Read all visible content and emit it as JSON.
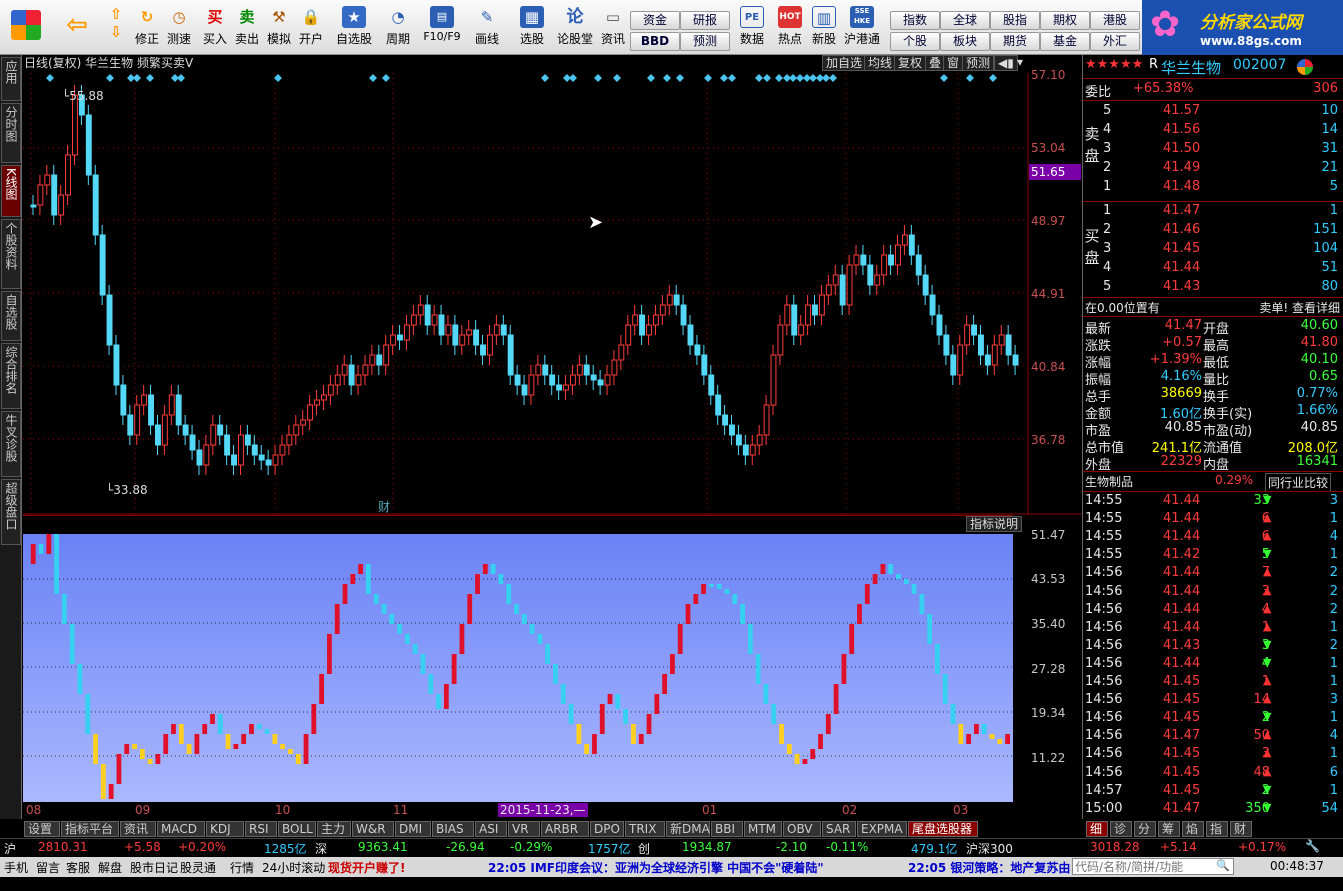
{
  "toolbar": {
    "buttons": [
      "修正",
      "测速",
      "买入",
      "卖出",
      "模拟",
      "开户",
      "自选股",
      "周期",
      "F10/F9",
      "画线",
      "选股",
      "论股堂",
      "资讯",
      "数据",
      "热点",
      "新股",
      "沪港通"
    ],
    "small_buttons": [
      "资金",
      "研报",
      "BBD",
      "预测",
      "指数",
      "全球",
      "股指",
      "期权",
      "港股",
      "个股",
      "板块",
      "期货",
      "基金",
      "外汇"
    ],
    "buy_icon": "买",
    "sell_icon": "卖",
    "lun_icon": "论",
    "pe_icon": "PE",
    "hot_icon": "HOT",
    "sse_icon": "SSE HKE"
  },
  "logo": {
    "title": "分析家公式网",
    "url": "www.88gs.com"
  },
  "left_tabs": [
    "应用",
    "分时图",
    "K线图",
    "个股资料",
    "自选股",
    "综合排名",
    "牛叉诊股",
    "超级盘口"
  ],
  "chart": {
    "header": "日线(复权)  华兰生物  频繁买卖V",
    "header_buttons": [
      "加自选",
      "均线",
      "复权",
      "叠",
      "窗",
      "预测"
    ],
    "high_label": "55.88",
    "low_label": "33.88",
    "cai_marker": "财",
    "price_axis": [
      "57.10",
      "53.04",
      "48.97",
      "44.91",
      "40.84",
      "36.78"
    ],
    "current_price_tag": "51.65",
    "indicator_btn": "指标说明",
    "ind_axis": [
      "51.47",
      "43.53",
      "35.40",
      "27.28",
      "19.34",
      "11.22"
    ],
    "x_labels": [
      "08",
      "09",
      "10",
      "11",
      "01",
      "02",
      "03"
    ],
    "date_cursor": "2015-11-23,—"
  },
  "bottom_tabs": [
    "设置",
    "指标平台",
    "资讯",
    "MACD",
    "KDJ",
    "RSI",
    "BOLL",
    "主力",
    "W&R",
    "DMI",
    "BIAS",
    "ASI",
    "VR",
    "ARBR",
    "DPO",
    "TRIX",
    "新DMA",
    "BBI",
    "MTM",
    "OBV",
    "SAR",
    "EXPMA",
    "尾盘选股器"
  ],
  "right_bottom_tabs": [
    "细",
    "诊",
    "分",
    "筹",
    "焰",
    "指",
    "财"
  ],
  "stock": {
    "name": "华兰生物",
    "code": "002007",
    "mark": "R",
    "weibi_label": "委比",
    "weibi": "+65.38%",
    "weibi_num": "306",
    "sell_label": "卖盘",
    "buy_label": "买盘",
    "asks": [
      {
        "lvl": "5",
        "price": "41.57",
        "vol": "10"
      },
      {
        "lvl": "4",
        "price": "41.56",
        "vol": "14"
      },
      {
        "lvl": "3",
        "price": "41.50",
        "vol": "31"
      },
      {
        "lvl": "2",
        "price": "41.49",
        "vol": "21"
      },
      {
        "lvl": "1",
        "price": "41.48",
        "vol": "5"
      }
    ],
    "bids": [
      {
        "lvl": "1",
        "price": "41.47",
        "vol": "1"
      },
      {
        "lvl": "2",
        "price": "41.46",
        "vol": "151"
      },
      {
        "lvl": "3",
        "price": "41.45",
        "vol": "104"
      },
      {
        "lvl": "4",
        "price": "41.44",
        "vol": "51"
      },
      {
        "lvl": "5",
        "price": "41.43",
        "vol": "80"
      }
    ],
    "pos_label": "在0.00位置有",
    "pos_right": "卖单! 查看详细",
    "stats": [
      {
        "k1": "最新",
        "v1": "41.47",
        "c1": "red",
        "k2": "开盘",
        "v2": "40.60",
        "c2": "grn"
      },
      {
        "k1": "涨跌",
        "v1": "+0.57",
        "c1": "red",
        "k2": "最高",
        "v2": "41.80",
        "c2": "red"
      },
      {
        "k1": "涨幅",
        "v1": "+1.39%",
        "c1": "red",
        "k2": "最低",
        "v2": "40.10",
        "c2": "grn"
      },
      {
        "k1": "振幅",
        "v1": "4.16%",
        "c1": "cyan",
        "k2": "量比",
        "v2": "0.65",
        "c2": "grn"
      },
      {
        "k1": "总手",
        "v1": "38669",
        "c1": "yel",
        "k2": "换手",
        "v2": "0.77%",
        "c2": "cyan"
      },
      {
        "k1": "金额",
        "v1": "1.60亿",
        "c1": "cyan",
        "k2": "换手(实)",
        "v2": "1.66%",
        "c2": "cyan"
      },
      {
        "k1": "市盈",
        "v1": "40.85",
        "c1": "wht",
        "k2": "市盈(动)",
        "v2": "40.85",
        "c2": "wht"
      },
      {
        "k1": "总市值",
        "v1": "241.1亿",
        "c1": "yel",
        "k2": "流通值",
        "v2": "208.0亿",
        "c2": "yel"
      },
      {
        "k1": "外盘",
        "v1": "22329",
        "c1": "red",
        "k2": "内盘",
        "v2": "16341",
        "c2": "grn"
      }
    ],
    "industry": "生物制品",
    "industry_pct": "0.29%",
    "industry_btn": "同行业比较",
    "ticks": [
      {
        "t": "14:55",
        "p": "41.44",
        "v": "33",
        "d": "down",
        "n": "3"
      },
      {
        "t": "14:55",
        "p": "41.44",
        "v": "6",
        "d": "up",
        "n": "1"
      },
      {
        "t": "14:55",
        "p": "41.44",
        "v": "6",
        "d": "up",
        "n": "4"
      },
      {
        "t": "14:55",
        "p": "41.42",
        "v": "5",
        "d": "down",
        "n": "1"
      },
      {
        "t": "14:56",
        "p": "41.44",
        "v": "7",
        "d": "up",
        "n": "2"
      },
      {
        "t": "14:56",
        "p": "41.44",
        "v": "3",
        "d": "up",
        "n": "2"
      },
      {
        "t": "14:56",
        "p": "41.44",
        "v": "4",
        "d": "up",
        "n": "2"
      },
      {
        "t": "14:56",
        "p": "41.44",
        "v": "1",
        "d": "up",
        "n": "1"
      },
      {
        "t": "14:56",
        "p": "41.43",
        "v": "3",
        "d": "down",
        "n": "2"
      },
      {
        "t": "14:56",
        "p": "41.44",
        "v": "4",
        "d": "down",
        "n": "1"
      },
      {
        "t": "14:56",
        "p": "41.45",
        "v": "1",
        "d": "up",
        "n": "1"
      },
      {
        "t": "14:56",
        "p": "41.45",
        "v": "14",
        "d": "up",
        "n": "3"
      },
      {
        "t": "14:56",
        "p": "41.45",
        "v": "2",
        "d": "down",
        "n": "1"
      },
      {
        "t": "14:56",
        "p": "41.47",
        "v": "50",
        "d": "up",
        "n": "4"
      },
      {
        "t": "14:56",
        "p": "41.45",
        "v": "3",
        "d": "up",
        "n": "1"
      },
      {
        "t": "14:56",
        "p": "41.45",
        "v": "48",
        "d": "up",
        "n": "6"
      },
      {
        "t": "14:57",
        "p": "41.45",
        "v": "2",
        "d": "down",
        "n": "1"
      },
      {
        "t": "15:00",
        "p": "41.47",
        "v": "350",
        "d": "down",
        "n": "54"
      }
    ]
  },
  "status": {
    "sh_label": "沪",
    "sh_val": "2810.31",
    "sh_chg": "+5.58",
    "sh_pct": "+0.20%",
    "sh_amt": "1285亿",
    "sz_label": "深",
    "sz_val": "9363.41",
    "sz_chg": "-26.94",
    "sz_pct": "-0.29%",
    "sz_amt": "1757亿",
    "cy_label": "创",
    "cy_val": "1934.87",
    "cy_chg": "-2.10",
    "cy_pct": "-0.11%",
    "cy_amt": "479.1亿",
    "hs_label": "沪深300",
    "hs_val": "3018.28",
    "hs_chg": "+5.14",
    "hs_pct": "+0.17%"
  },
  "ticker": {
    "items": [
      "手机",
      "留言",
      "客服",
      "解盘",
      "股市日记",
      "股灵通",
      "行情",
      "24小时滚动"
    ],
    "news1": "现货开户赚了!",
    "news2": "22:05 IMF印度会议：亚洲为全球经济引擎 中国不会\"硬着陆\"",
    "news3": "22:05 银河策略：地产复苏由",
    "search_placeholder": "代码/名称/简拼/功能",
    "time": "00:48:37"
  }
}
